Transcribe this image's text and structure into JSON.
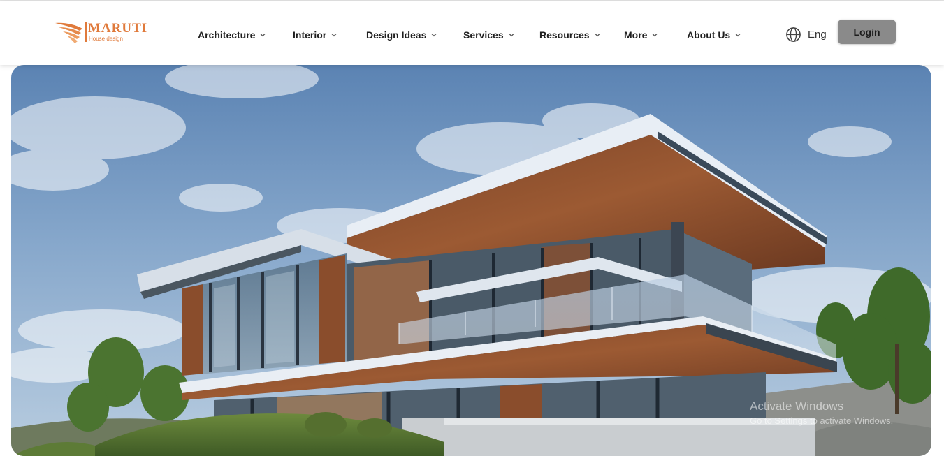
{
  "brand": {
    "name": "MARUTI",
    "tagline": "House design",
    "accent_color": "#e07a3b"
  },
  "nav": {
    "items": [
      {
        "label": "Architecture",
        "icon": "chevron-down-icon"
      },
      {
        "label": "Interior",
        "icon": "chevron-down-icon"
      },
      {
        "label": "Design Ideas",
        "icon": "chevron-down-icon"
      },
      {
        "label": "Services",
        "icon": "chevron-down-icon"
      },
      {
        "label": "Resources",
        "icon": "chevron-down-icon"
      },
      {
        "label": "More",
        "icon": "chevron-down-icon"
      },
      {
        "label": "About Us",
        "icon": "chevron-down-icon"
      }
    ],
    "language": {
      "label": "Eng",
      "icon": "globe-icon"
    },
    "login_label": "Login",
    "login_color": "#8a8a8a"
  },
  "hero": {
    "image": "modern-cantilever-house-photo"
  },
  "system_watermark": {
    "title": "Activate Windows",
    "subtitle": "Go to Settings to activate Windows."
  }
}
